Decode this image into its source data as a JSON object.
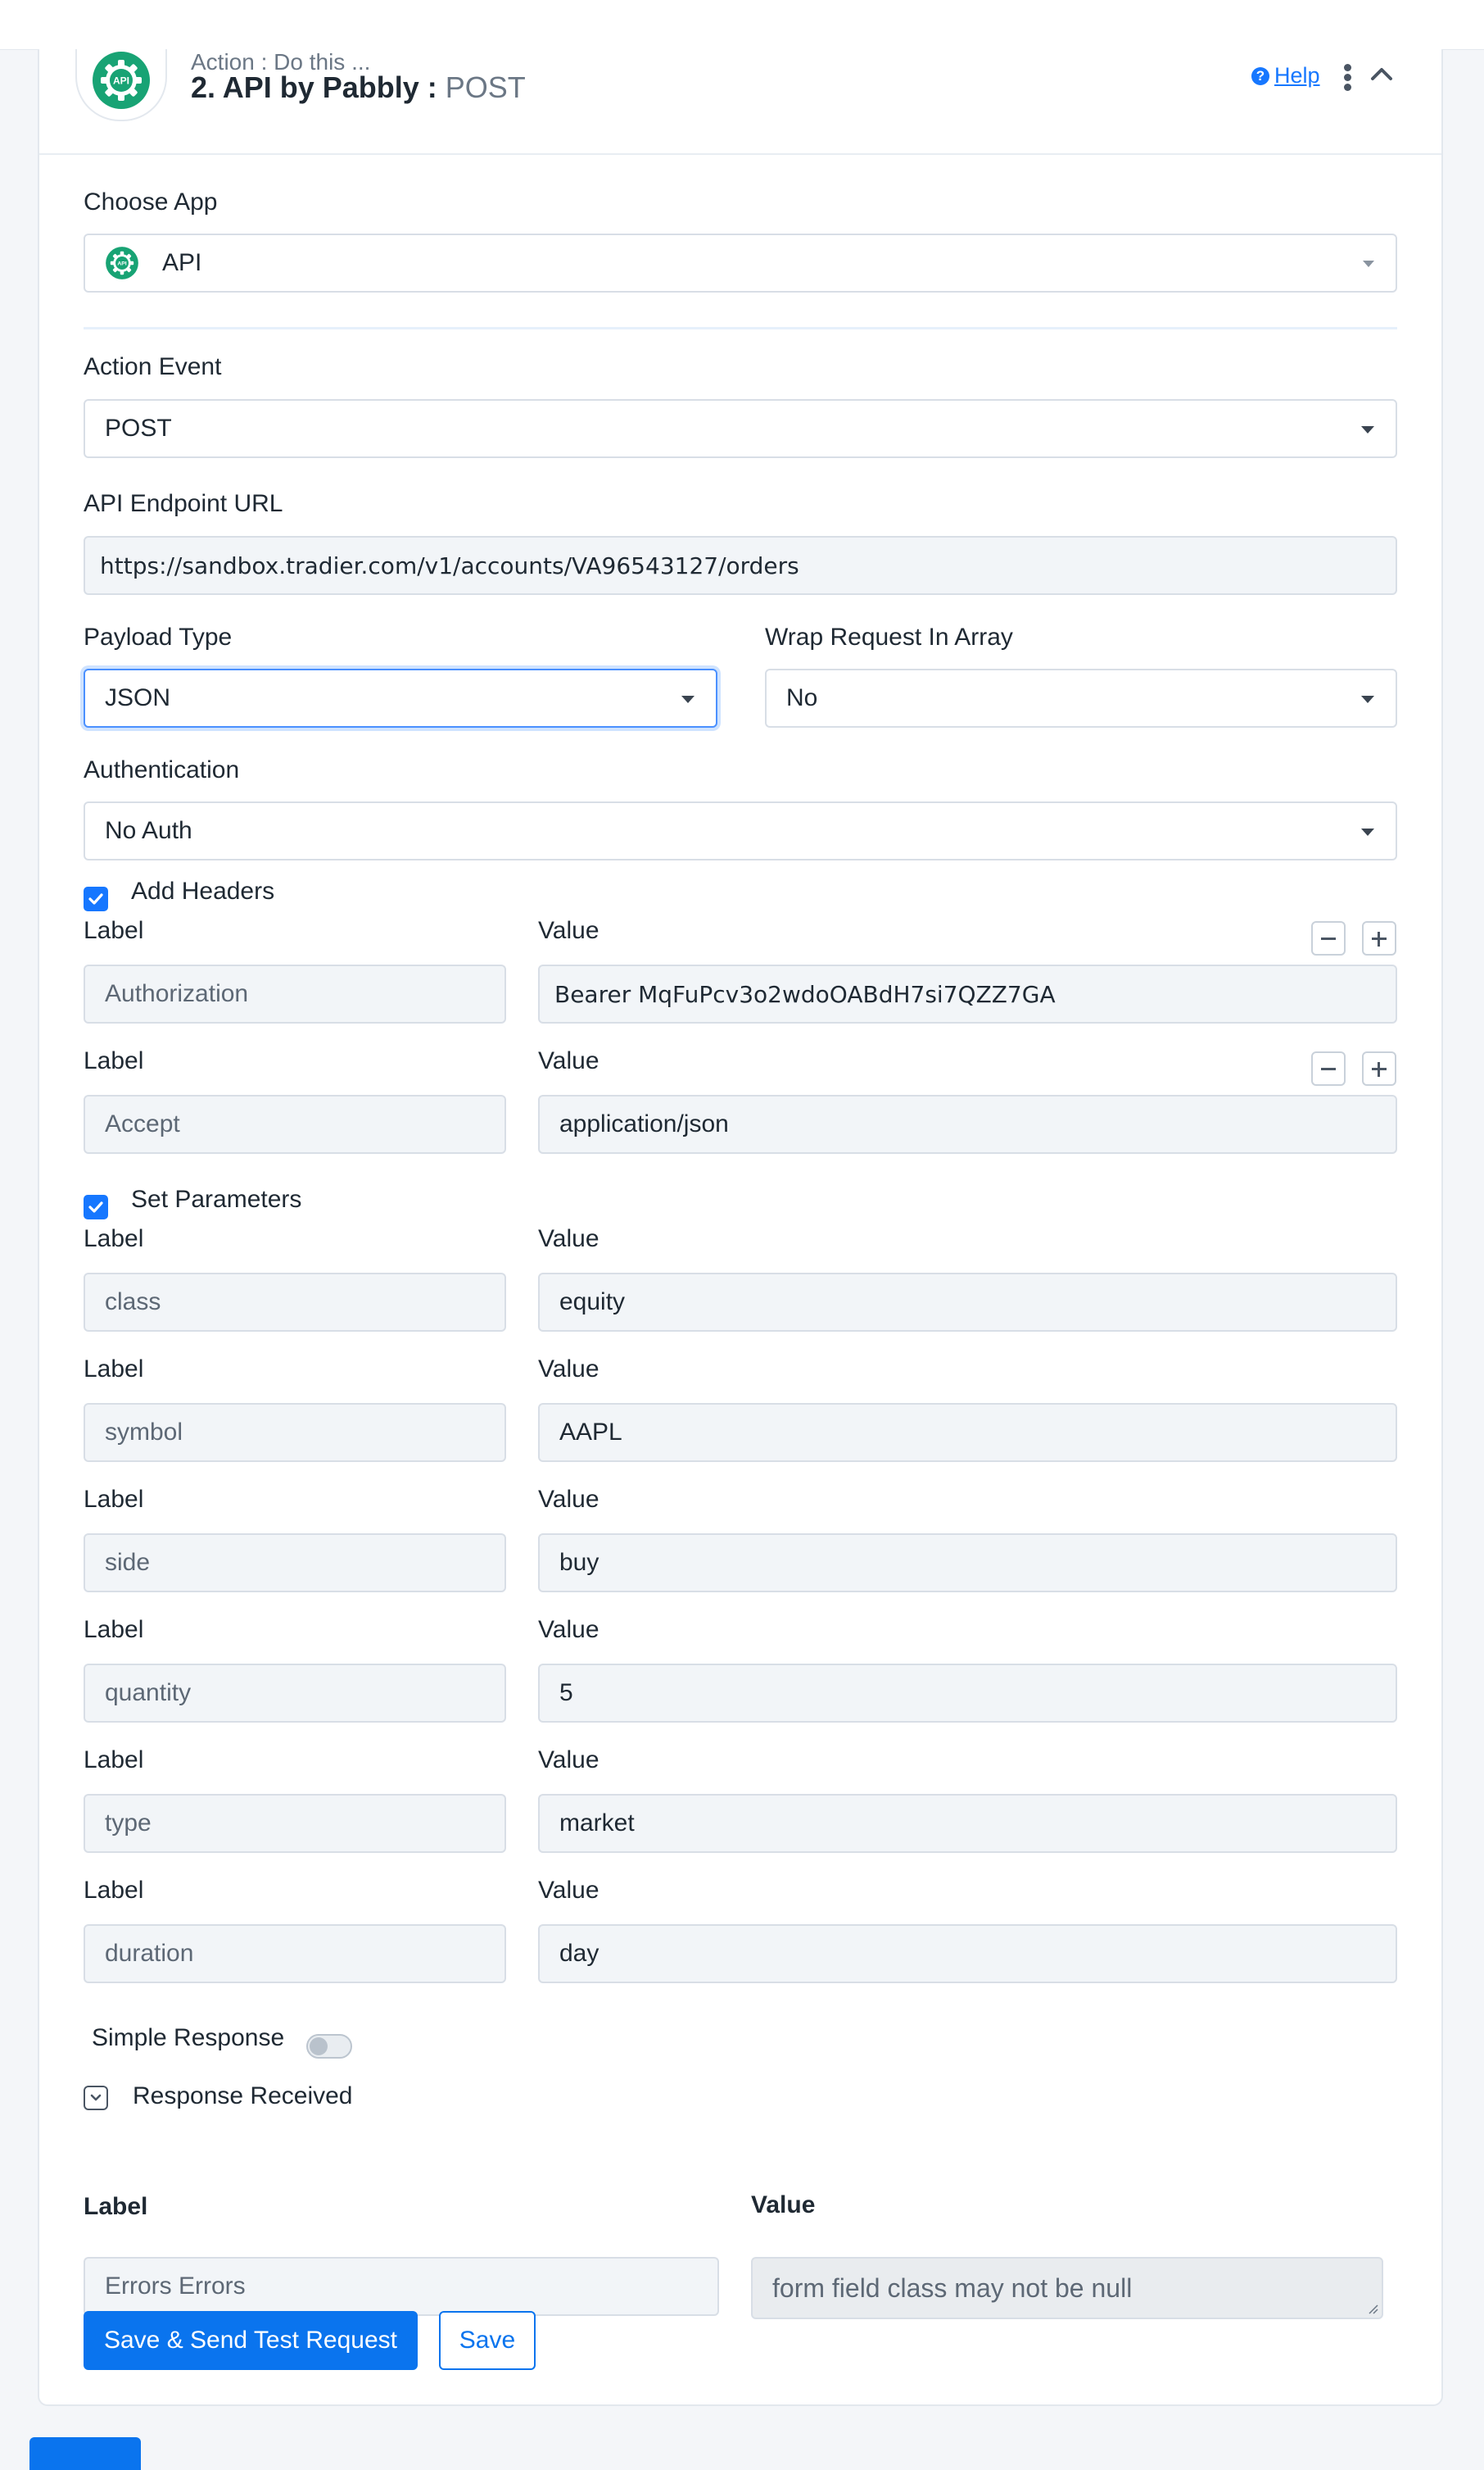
{
  "colors": {
    "primary": "#0a74ee",
    "app_green": "#18a374",
    "link": "#1677ff"
  },
  "header": {
    "kicker": "Action : Do this ...",
    "step": "2. API by Pabbly :",
    "method": "POST",
    "help": "Help",
    "app_icon": "api-gear-icon"
  },
  "choose_app": {
    "label": "Choose App",
    "value": "API",
    "icon_text": "API"
  },
  "action_event": {
    "label": "Action Event",
    "value": "POST"
  },
  "endpoint": {
    "label": "API Endpoint URL",
    "value": "https://sandbox.tradier.com/v1/accounts/VA96543127/orders"
  },
  "payload_type": {
    "label": "Payload Type",
    "value": "JSON"
  },
  "wrap_request": {
    "label": "Wrap Request In Array",
    "value": "No"
  },
  "authentication": {
    "label": "Authentication",
    "value": "No Auth"
  },
  "headers": {
    "title": "Add Headers",
    "checked": true,
    "rows": [
      {
        "label_caption": "Label",
        "value_caption": "Value",
        "label": "Authorization",
        "value": "Bearer MqFuPcv3o2wdoOABdH7si7QZZ7GA"
      },
      {
        "label_caption": "Label",
        "value_caption": "Value",
        "label": "Accept",
        "value": "application/json"
      }
    ]
  },
  "parameters": {
    "title": "Set Parameters",
    "checked": true,
    "rows": [
      {
        "label_caption": "Label",
        "value_caption": "Value",
        "label": "class",
        "value": "equity"
      },
      {
        "label_caption": "Label",
        "value_caption": "Value",
        "label": "symbol",
        "value": "AAPL"
      },
      {
        "label_caption": "Label",
        "value_caption": "Value",
        "label": "side",
        "value": "buy"
      },
      {
        "label_caption": "Label",
        "value_caption": "Value",
        "label": "quantity",
        "value": "5"
      },
      {
        "label_caption": "Label",
        "value_caption": "Value",
        "label": "type",
        "value": "market"
      },
      {
        "label_caption": "Label",
        "value_caption": "Value",
        "label": "duration",
        "value": "day"
      }
    ]
  },
  "simple_response": {
    "label": "Simple Response",
    "enabled": false
  },
  "response": {
    "title": "Response Received",
    "label_caption": "Label",
    "value_caption": "Value",
    "label": "Errors Errors",
    "value": "form field class may not be null"
  },
  "buttons": {
    "save_send": "Save & Send Test Request",
    "save": "Save"
  }
}
